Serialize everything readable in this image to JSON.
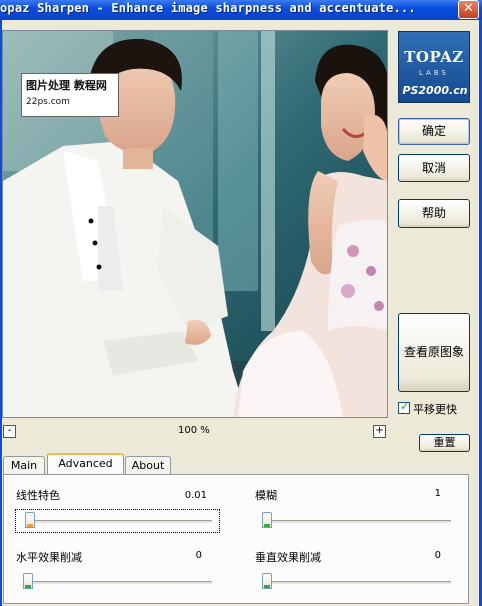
{
  "window": {
    "title": "opaz Sharpen - Enhance image sharpness and accentuate...",
    "close_glyph": "✕"
  },
  "preview": {
    "watermark_cn": "图片处理 教程网",
    "watermark_url": "22ps.com"
  },
  "logo": {
    "name": "TOPAZ",
    "sub": "LABS",
    "site": "PS2000.cn"
  },
  "buttons": {
    "ok": "确定",
    "cancel": "取消",
    "help": "帮助",
    "original": "查看原图象",
    "reset": "重置"
  },
  "pan": {
    "label": "平移更快",
    "checked": true
  },
  "zoom": {
    "minus": "-",
    "plus": "+",
    "value": "100 %"
  },
  "tabs": [
    {
      "label": "Main",
      "active": false
    },
    {
      "label": "Advanced",
      "active": true
    },
    {
      "label": "About",
      "active": false
    }
  ],
  "sliders": {
    "linear_feature": {
      "label": "线性特色",
      "value": "0.01"
    },
    "blur": {
      "label": "模糊",
      "value": "1"
    },
    "horizontal_reduction": {
      "label": "水平效果削减",
      "value": "0"
    },
    "vertical_reduction": {
      "label": "垂直效果削减",
      "value": "0"
    }
  },
  "colors": {
    "titlebar": "#0a4ee0",
    "dialog_bg": "#ece9d8",
    "logo_bg": "#1d5aa3",
    "active_tab_accent": "#f3b84a"
  }
}
